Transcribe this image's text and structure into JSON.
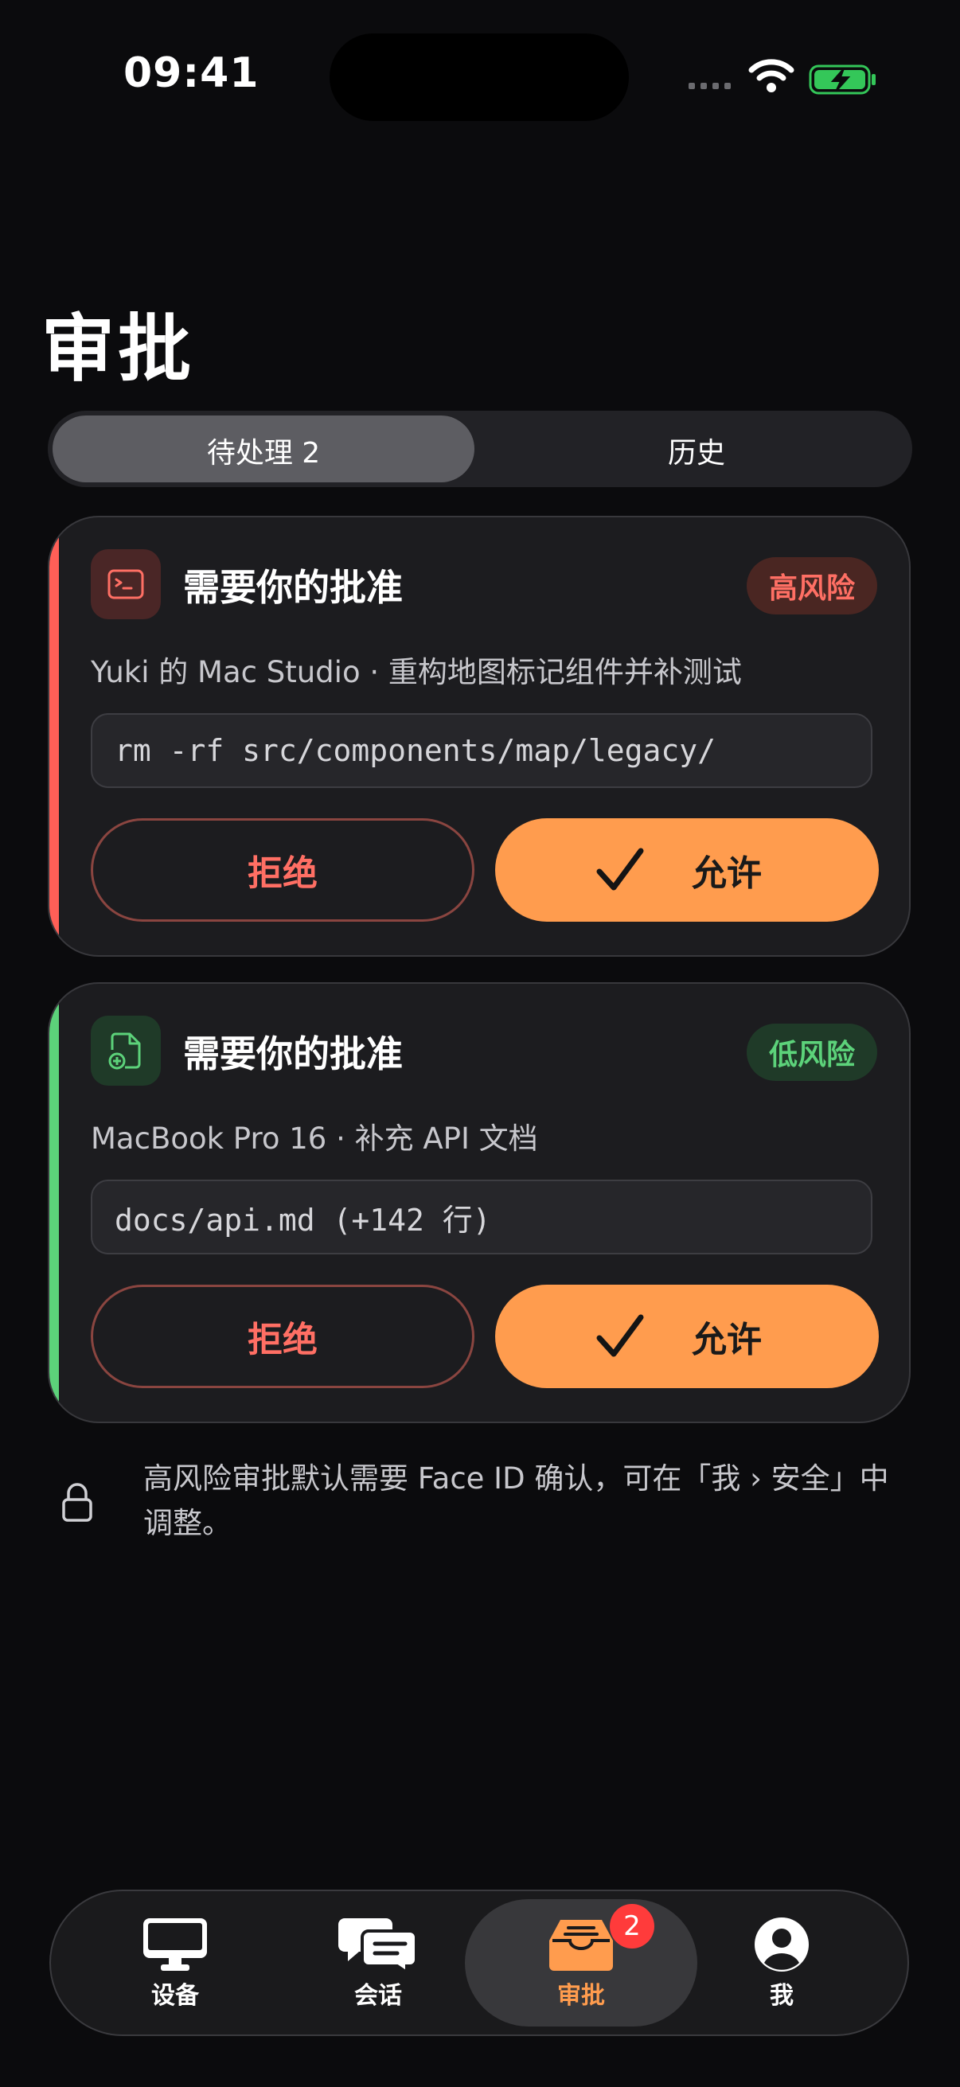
{
  "status_bar": {
    "time": "09:41"
  },
  "page": {
    "title": "审批"
  },
  "segments": [
    {
      "label": "待处理 2",
      "selected": true
    },
    {
      "label": "历史",
      "selected": false
    }
  ],
  "cards": [
    {
      "title": "需要你的批准",
      "risk": "高风险",
      "description": "Yuki 的 Mac Studio · 重构地图标记组件并补测试",
      "command": "rm -rf src/components/map/legacy/",
      "reject_label": "拒绝",
      "allow_label": "允许",
      "icon": "terminal-icon",
      "accent_color": "#ff5f57"
    },
    {
      "title": "需要你的批准",
      "risk": "低风险",
      "description": "MacBook Pro 16 · 补充 API 文档",
      "command": "docs/api.md (+142 行)",
      "reject_label": "拒绝",
      "allow_label": "允许",
      "icon": "file-add-icon",
      "accent_color": "#5cd27a"
    }
  ],
  "footnote": {
    "text": "高风险审批默认需要 Face ID 确认，可在「我 › 安全」中调整。",
    "icon": "lock-icon"
  },
  "tabbar": {
    "items": [
      {
        "label": "设备",
        "icon": "monitor-icon"
      },
      {
        "label": "会话",
        "icon": "chat-bubbles-icon"
      },
      {
        "label": "审批",
        "icon": "inbox-tray-icon",
        "badge": "2",
        "active": true
      },
      {
        "label": "我",
        "icon": "person-icon"
      }
    ]
  },
  "colors": {
    "accent_orange": "#ff9c4e",
    "danger": "#ff6f64",
    "success": "#5cd27a"
  }
}
